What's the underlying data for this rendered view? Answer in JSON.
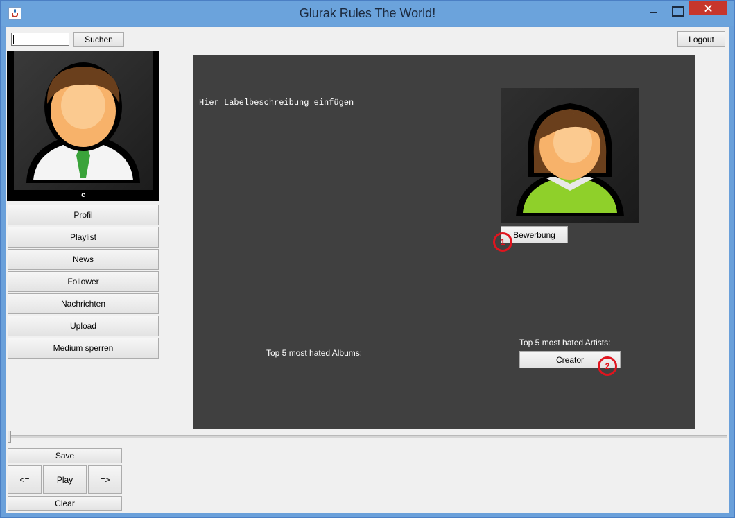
{
  "window": {
    "title": "Glurak Rules The World!"
  },
  "toolbar": {
    "search_value": "",
    "search_label": "Suchen",
    "logout_label": "Logout"
  },
  "profile": {
    "name": "c"
  },
  "nav": [
    {
      "label": "Profil"
    },
    {
      "label": "Playlist"
    },
    {
      "label": "News"
    },
    {
      "label": "Follower"
    },
    {
      "label": "Nachrichten"
    },
    {
      "label": "Upload"
    },
    {
      "label": "Medium sperren"
    }
  ],
  "main": {
    "label_description": "Hier Labelbeschreibung einfügen",
    "apply_label": "Bewerbung",
    "hated_albums_label": "Top 5 most hated Albums:",
    "hated_artists_label": "Top 5 most hated Artists:",
    "creator_label": "Creator",
    "marker_1": "1",
    "marker_2": "2"
  },
  "player": {
    "save_label": "Save",
    "prev_label": "<=",
    "play_label": "Play",
    "next_label": "=>",
    "clear_label": "Clear"
  },
  "colors": {
    "content_bg": "#404040",
    "marker": "#e0141e",
    "titlebar": "#6ba3dc"
  }
}
